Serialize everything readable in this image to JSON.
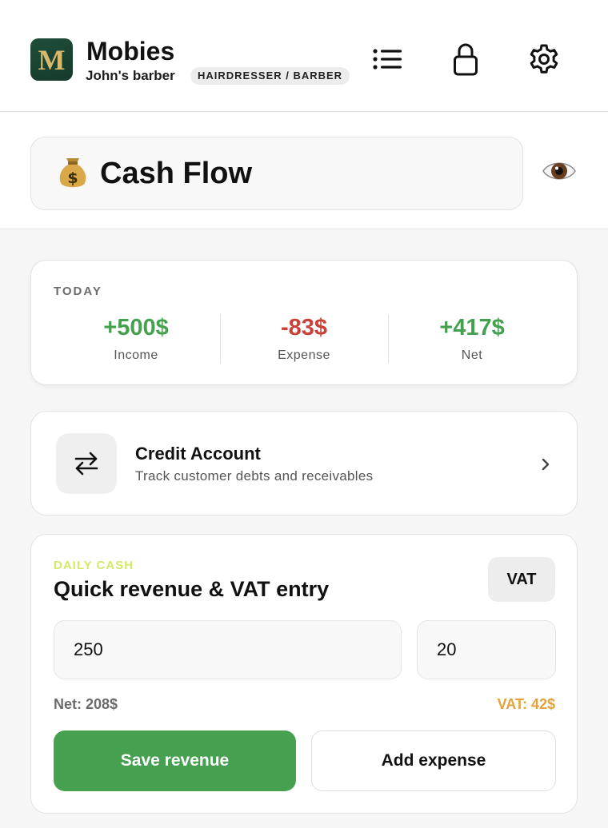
{
  "header": {
    "logo_letter": "M",
    "app_name": "Mobies",
    "business_name": "John's barber",
    "business_type": "HAIRDRESSER / BARBER",
    "icons": [
      "list-menu-icon",
      "lock-icon",
      "gear-icon"
    ]
  },
  "page": {
    "title": "Cash Flow",
    "title_icon": "money-bag-icon",
    "visibility_icon": "eye-icon"
  },
  "today": {
    "label": "TODAY",
    "income": {
      "value": "+500$",
      "label": "Income"
    },
    "expense": {
      "value": "-83$",
      "label": "Expense"
    },
    "net": {
      "value": "+417$",
      "label": "Net"
    }
  },
  "credit": {
    "title": "Credit Account",
    "subtitle": "Track customer debts and receivables",
    "icon": "swap-arrows-icon"
  },
  "daily": {
    "kicker": "DAILY CASH",
    "title": "Quick revenue & VAT entry",
    "vat_button": "VAT",
    "amount_value": "250",
    "rate_value": "20",
    "net_text": "Net: 208$",
    "vat_text": "VAT: 42$",
    "save_label": "Save revenue",
    "add_label": "Add expense"
  },
  "colors": {
    "positive": "#45a04f",
    "negative": "#c8423a",
    "vat_accent": "#e3a23b",
    "kicker": "#d4e96a",
    "logo_bg": "#1f4e3a",
    "logo_letter": "#d8b86a"
  }
}
